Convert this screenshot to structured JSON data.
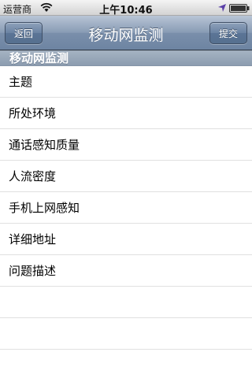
{
  "status_bar": {
    "carrier": "运营商",
    "time": "上午10:46",
    "icons": [
      "wifi-icon",
      "location-icon",
      "battery-icon"
    ]
  },
  "nav_bar": {
    "title": "移动网监测",
    "back_label": "返回",
    "submit_label": "提交"
  },
  "section": {
    "header": "移动网监测"
  },
  "list": {
    "items": [
      {
        "label": "主题"
      },
      {
        "label": "所处环境"
      },
      {
        "label": "通话感知质量"
      },
      {
        "label": "人流密度"
      },
      {
        "label": "手机上网感知"
      },
      {
        "label": "详细地址"
      },
      {
        "label": "问题描述"
      }
    ],
    "empty_rows": 3
  },
  "colors": {
    "nav_bar": "#7a8fab",
    "section_header": "#98a7b9",
    "separator": "#e0e0e0"
  }
}
